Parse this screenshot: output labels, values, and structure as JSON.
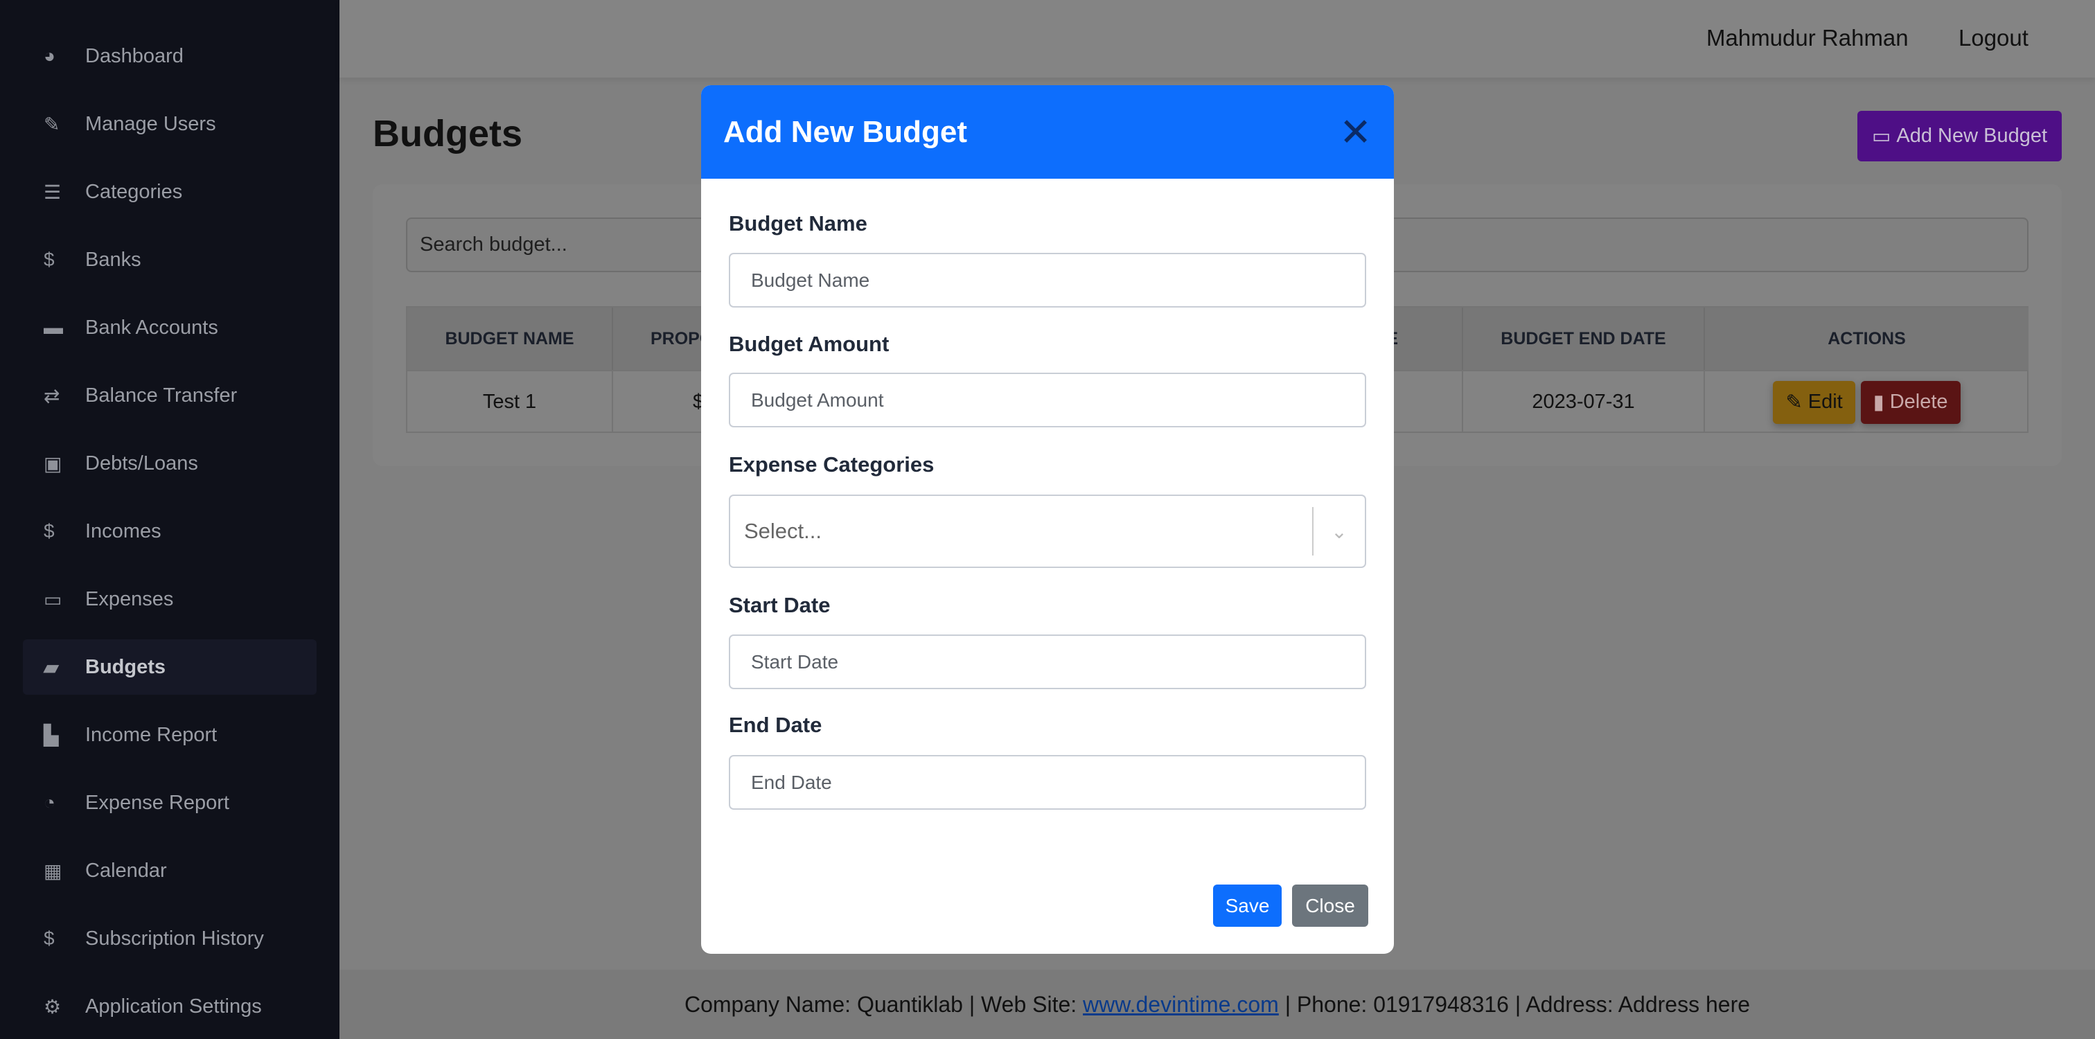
{
  "sidebar": {
    "items": [
      {
        "label": "Dashboard",
        "icon": "gauge-icon",
        "glyph": "◕"
      },
      {
        "label": "Manage Users",
        "icon": "edit-icon",
        "glyph": "✎"
      },
      {
        "label": "Categories",
        "icon": "list-icon",
        "glyph": "☰"
      },
      {
        "label": "Banks",
        "icon": "dollar-icon",
        "glyph": "$"
      },
      {
        "label": "Bank Accounts",
        "icon": "id-card-icon",
        "glyph": "▬"
      },
      {
        "label": "Balance Transfer",
        "icon": "exchange-icon",
        "glyph": "⇄"
      },
      {
        "label": "Debts/Loans",
        "icon": "hand-money-icon",
        "glyph": "▣"
      },
      {
        "label": "Incomes",
        "icon": "dollar-icon",
        "glyph": "$"
      },
      {
        "label": "Expenses",
        "icon": "money-bill-icon",
        "glyph": "▭"
      },
      {
        "label": "Budgets",
        "icon": "wallet-icon",
        "glyph": "▰",
        "active": true
      },
      {
        "label": "Income Report",
        "icon": "chart-line-icon",
        "glyph": "▙"
      },
      {
        "label": "Expense Report",
        "icon": "chart-pie-icon",
        "glyph": "◔"
      },
      {
        "label": "Calendar",
        "icon": "calendar-icon",
        "glyph": "▦"
      },
      {
        "label": "Subscription History",
        "icon": "dollar-icon",
        "glyph": "$"
      },
      {
        "label": "Application Settings",
        "icon": "gears-icon",
        "glyph": "⚙"
      }
    ]
  },
  "header": {
    "user": "Mahmudur Rahman",
    "logout": "Logout"
  },
  "page": {
    "title": "Budgets",
    "add_button": "Add New Budget",
    "search_placeholder": "Search budget..."
  },
  "table": {
    "headers": {
      "name": "BUDGET NAME",
      "proposed_partial": "PROPO",
      "start_partial": "ATE",
      "end": "BUDGET END DATE",
      "actions": "ACTIONS"
    },
    "rows": [
      {
        "name": "Test 1",
        "proposed_partial": "$",
        "end": "2023-07-31"
      }
    ],
    "edit": "Edit",
    "delete": "Delete"
  },
  "modal": {
    "title": "Add New Budget",
    "fields": {
      "name": {
        "label": "Budget Name",
        "placeholder": "Budget Name"
      },
      "amount": {
        "label": "Budget Amount",
        "placeholder": "Budget Amount"
      },
      "categories": {
        "label": "Expense Categories",
        "placeholder": "Select..."
      },
      "start": {
        "label": "Start Date",
        "placeholder": "Start Date"
      },
      "end": {
        "label": "End Date",
        "placeholder": "End Date"
      }
    },
    "save": "Save",
    "close": "Close"
  },
  "footer": {
    "company": "Company Name: Quantiklab | Web Site: ",
    "link": "www.devintime.com",
    "rest": " | Phone: 01917948316 | Address: Address here"
  },
  "colors": {
    "primary": "#0d6efd",
    "secondary": "#6c757d",
    "purple": "#6f16c8",
    "warning": "#ffc107",
    "danger": "#dc3545"
  }
}
